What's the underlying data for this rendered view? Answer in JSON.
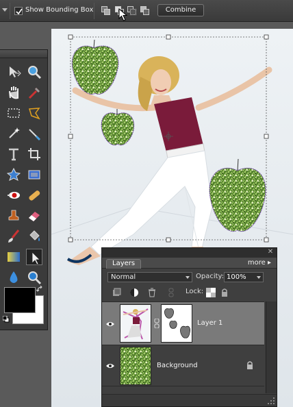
{
  "options_bar": {
    "show_bounding_box_label": "Show Bounding Box",
    "show_bounding_box_checked": true,
    "combine_label": "Combine",
    "shape_modes": [
      "add",
      "subtract",
      "intersect",
      "exclude"
    ]
  },
  "toolbox": {
    "tools": [
      "move-tool",
      "zoom-tool",
      "hand-tool",
      "eyedropper-tool",
      "marquee-tool",
      "lasso-tool",
      "magic-wand-tool",
      "selection-brush-tool",
      "type-tool",
      "crop-tool",
      "cookie-cutter-tool",
      "straighten-tool",
      "red-eye-tool",
      "healing-brush-tool",
      "clone-stamp-tool",
      "eraser-tool",
      "brush-tool",
      "paint-bucket-tool",
      "gradient-tool",
      "shape-selection-tool",
      "blur-tool",
      "sponge-tool"
    ],
    "foreground_color": "#000000",
    "background_color": "#ffffff"
  },
  "layers": {
    "tab_label": "Layers",
    "more_label": "more ▸",
    "close_label": "✕",
    "blend_mode": "Normal",
    "opacity_label": "Opacity:",
    "opacity_value": "100%",
    "lock_label": "Lock:",
    "items": [
      {
        "name": "Layer 1",
        "selected": true,
        "visible": true,
        "has_mask": true
      },
      {
        "name": "Background",
        "selected": false,
        "visible": true,
        "locked": true
      }
    ]
  }
}
